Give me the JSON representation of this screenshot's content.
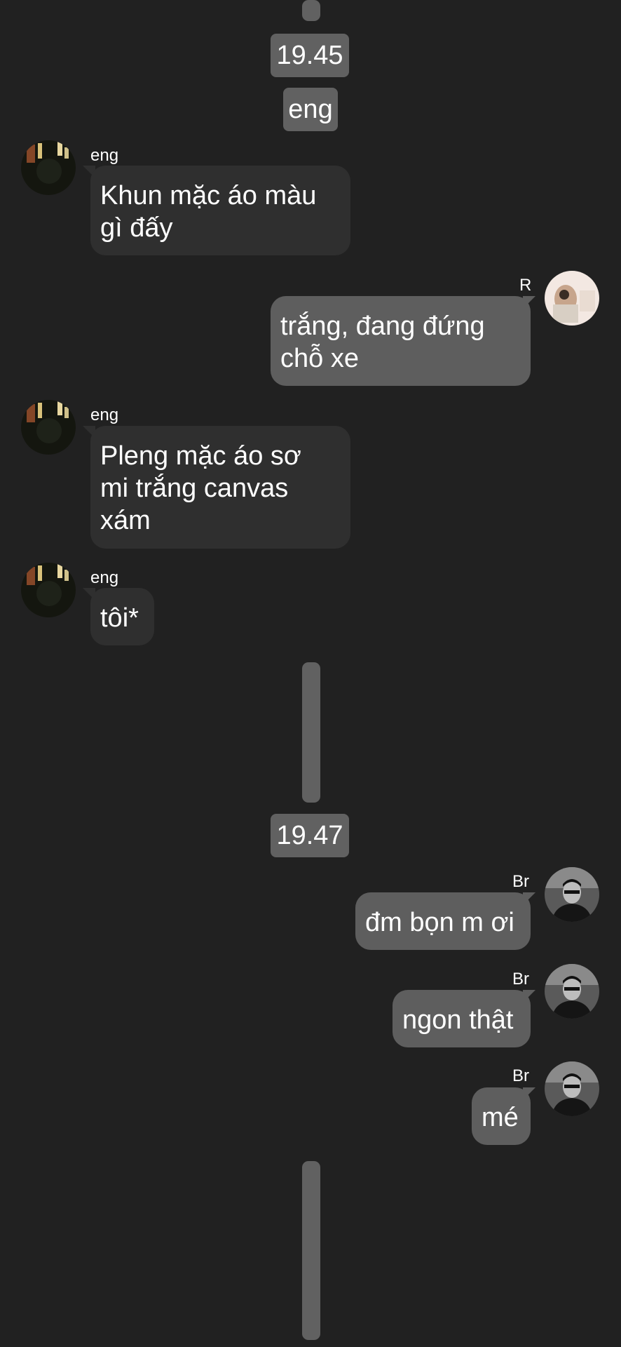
{
  "chat": {
    "time_1": "19.45",
    "group_label": "eng",
    "time_2": "19.47",
    "messages": [
      {
        "sender": "eng",
        "text": "Khun mặc áo màu\ngì đấy",
        "direction": "incoming",
        "avatar_icon": "dark-photo-avatar-icon"
      },
      {
        "sender": "R",
        "text": "trắng, đang đứng\nchỗ xe",
        "direction": "outgoing",
        "avatar_icon": "light-photo-avatar-icon"
      },
      {
        "sender": "eng",
        "text": "Pleng mặc áo sơ\nmi trắng canvas\nxám",
        "direction": "incoming",
        "avatar_icon": "dark-photo-avatar-icon"
      },
      {
        "sender": "eng",
        "text": "tôi*",
        "direction": "incoming",
        "avatar_icon": "dark-photo-avatar-icon"
      },
      {
        "sender": "Br",
        "text": "đm bọn m ơi",
        "direction": "outgoing",
        "avatar_icon": "bw-photo-avatar-icon"
      },
      {
        "sender": "Br",
        "text": "ngon thật",
        "direction": "outgoing",
        "avatar_icon": "bw-photo-avatar-icon"
      },
      {
        "sender": "Br",
        "text": "mé",
        "direction": "outgoing",
        "avatar_icon": "bw-photo-avatar-icon"
      }
    ]
  },
  "colors": {
    "background": "#212121",
    "incoming_bubble": "#2f2f2f",
    "outgoing_bubble": "#5e5e5e",
    "chip": "#616161"
  }
}
